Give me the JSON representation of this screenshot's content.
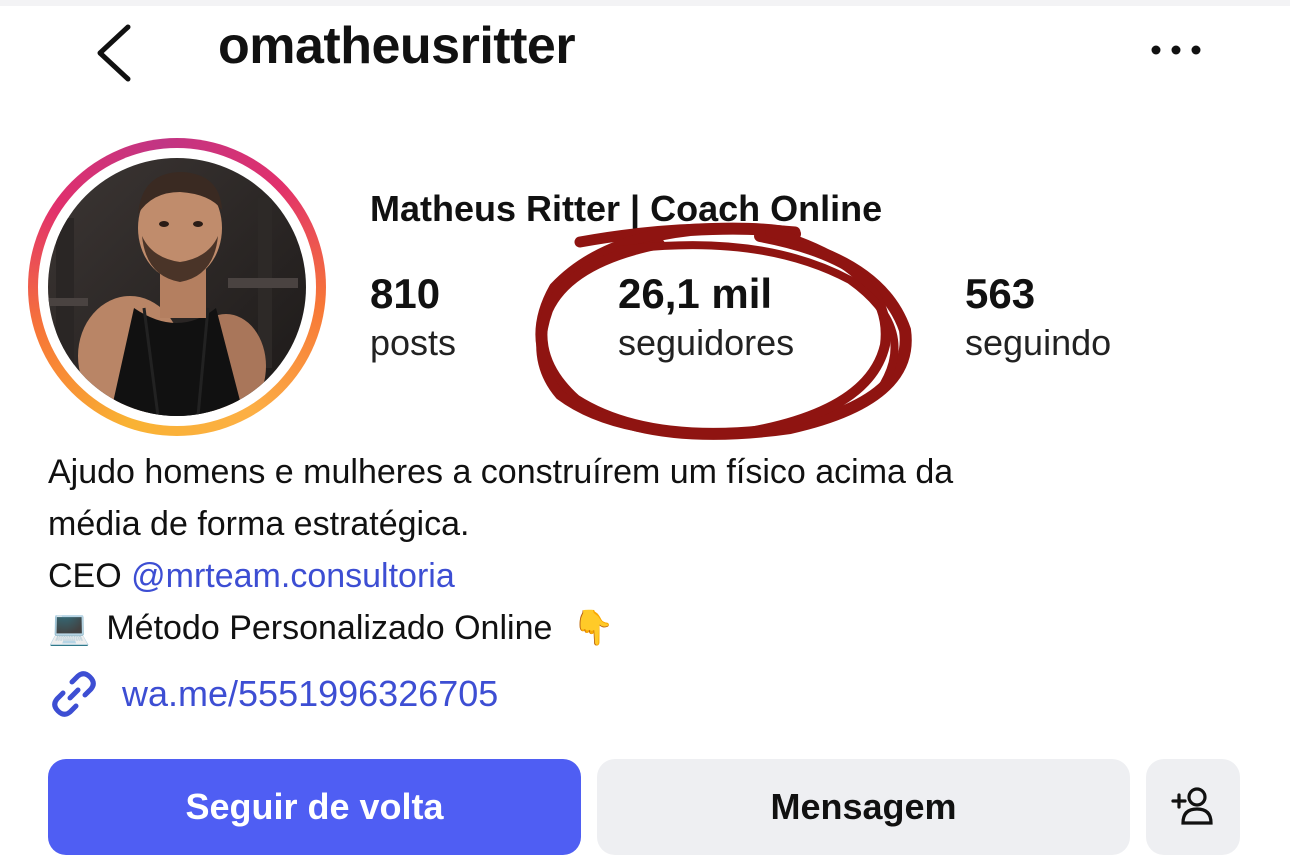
{
  "header": {
    "username": "omatheusritter",
    "back_icon": "chevron-left-icon",
    "more_icon": "more-horizontal-icon"
  },
  "profile": {
    "display_name": "Matheus Ritter | Coach Online",
    "stats": [
      {
        "value": "810",
        "label": "posts"
      },
      {
        "value": "26,1 mil",
        "label": "seguidores"
      },
      {
        "value": "563",
        "label": "seguindo"
      }
    ],
    "avatar_ring_colors": [
      "#f9b233",
      "#f77737",
      "#e1306c",
      "#c13584"
    ]
  },
  "bio": {
    "line1": "Ajudo homens e mulheres a construírem um físico acima da",
    "line2": "média de forma estratégica.",
    "line3_prefix": "CEO ",
    "line3_mention": "@mrteam.consultoria",
    "line4_emoji": "💻",
    "line4_text": "Método Personalizado Online",
    "line4_trailing_emoji": "👇",
    "link": "wa.me/5551996326705",
    "link_icon": "link-icon"
  },
  "actions": {
    "follow_label": "Seguir de volta",
    "message_label": "Mensagem",
    "add_person_icon": "add-person-icon"
  },
  "colors": {
    "accent_blue": "#4f5ef3",
    "link_blue": "#3d4ed3",
    "secondary_button": "#eeeff2",
    "annotation_red": "#8f1411"
  }
}
